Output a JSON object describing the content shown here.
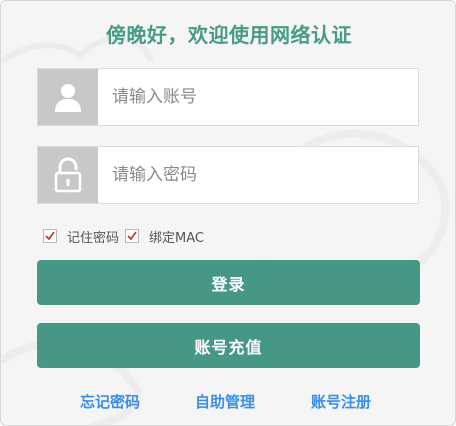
{
  "title": "傍晚好，欢迎使用网络认证",
  "account": {
    "placeholder": "请输入账号",
    "icon": "user-icon"
  },
  "password": {
    "placeholder": "请输入密码",
    "icon": "lock-icon"
  },
  "options": {
    "remember_password": {
      "label": "记住密码",
      "checked": true
    },
    "bind_mac": {
      "label": "绑定MAC",
      "checked": true
    }
  },
  "buttons": {
    "login": "登录",
    "recharge": "账号充值"
  },
  "links": {
    "forgot_password": "忘记密码",
    "self_service": "自助管理",
    "register": "账号注册"
  },
  "colors": {
    "accent": "#479786",
    "title": "#479b86",
    "link": "#3a8ee8",
    "check": "#c0392b"
  }
}
